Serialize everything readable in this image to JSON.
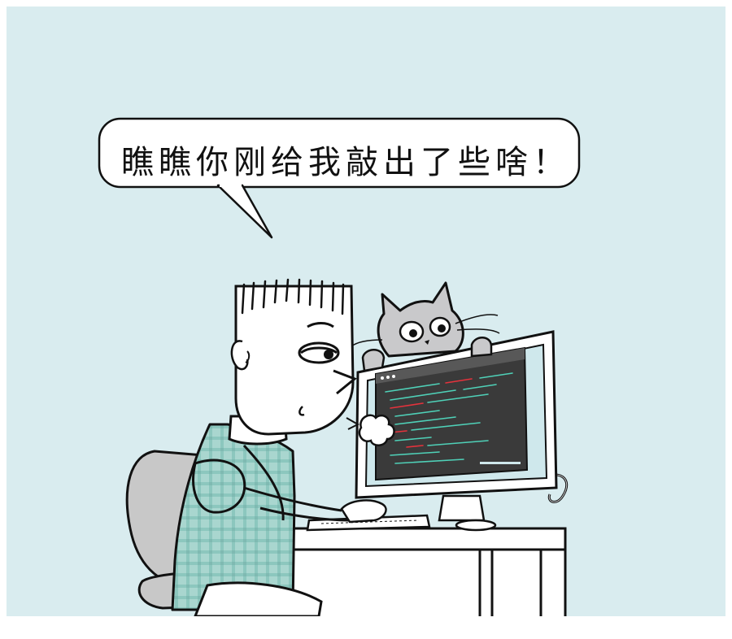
{
  "comic": {
    "speech_text": "瞧瞧你刚给我敲出了些啥！"
  },
  "colors": {
    "background": "#d9ecef",
    "shirt": "#a9d6cf",
    "chair": "#c8c8c8",
    "cat": "#c9c9cb",
    "screen": "#3a3a3a",
    "code_green": "#4fd1b8",
    "code_red": "#e5323c"
  }
}
